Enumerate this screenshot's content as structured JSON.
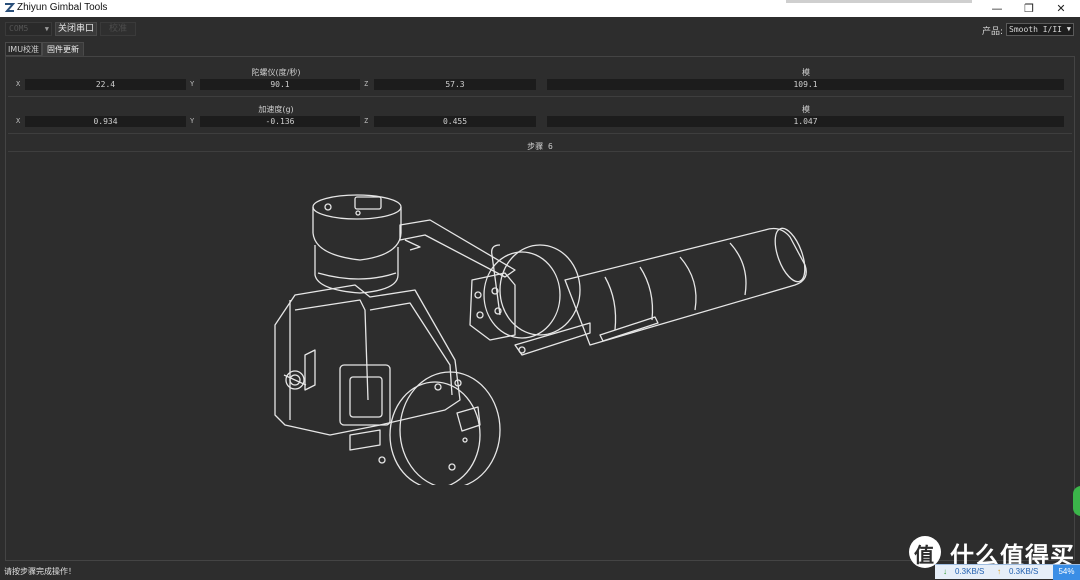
{
  "window": {
    "title": "Zhiyun Gimbal Tools",
    "minimize_icon": "minimize-icon",
    "restore_icon": "restore-icon",
    "close_icon": "close-icon"
  },
  "toolbar": {
    "port_value": "COM5",
    "close_port_label": "关闭串口",
    "disabled_button_label": "校准",
    "product_label": "产品:",
    "product_value": "Smooth I/II"
  },
  "tabs": [
    {
      "label": "IMU校准",
      "active": false
    },
    {
      "label": "固件更新",
      "active": true
    }
  ],
  "gyro": {
    "header": "陀螺仪(度/秒)",
    "x_label": "X",
    "x": "22.4",
    "y_label": "Y",
    "y": "90.1",
    "z_label": "Z",
    "z": "57.3",
    "mod_header": "模",
    "mod": "109.1"
  },
  "accel": {
    "header": "加速度(g)",
    "x_label": "X",
    "x": "0.934",
    "y_label": "Y",
    "y": "-0.136",
    "z_label": "Z",
    "z": "0.455",
    "mod_header": "模",
    "mod": "1.047"
  },
  "step": {
    "label": "步骤 6"
  },
  "status": {
    "message": "请按步骤完成操作！"
  },
  "network": {
    "down": "0.3KB/S",
    "up": "0.3KB/S",
    "percent": "54%"
  },
  "watermark": {
    "text": "什么值得买",
    "logo": "值"
  },
  "colors": {
    "background": "#2d2d2d",
    "field": "#1c1c1c",
    "line_art": "#e6e6e6"
  }
}
